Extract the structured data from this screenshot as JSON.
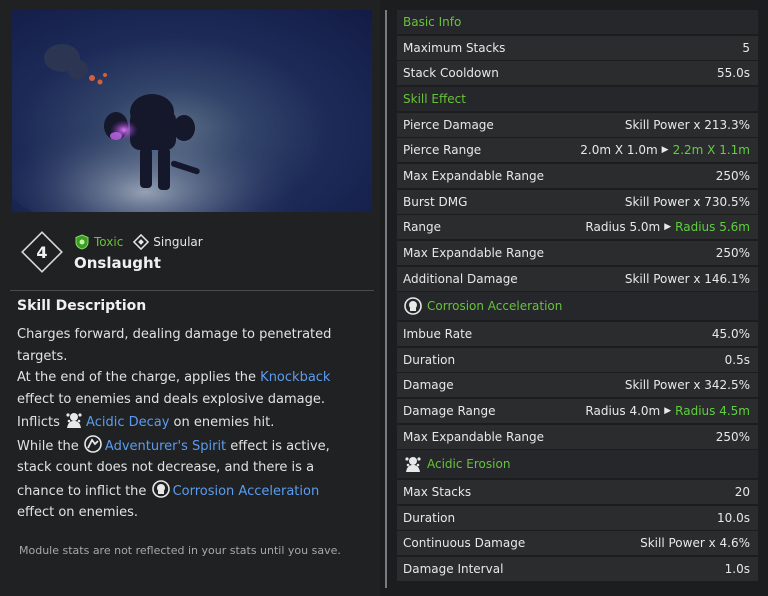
{
  "skill": {
    "slot_number": "4",
    "tags": [
      {
        "label": "Toxic",
        "icon": "toxic-icon",
        "color": "#67c23a"
      },
      {
        "label": "Singular",
        "icon": "singular-icon",
        "color": "#e6e6e6"
      }
    ],
    "name": "Onslaught"
  },
  "description": {
    "title": "Skill Description",
    "line1": "Charges forward, dealing damage to penetrated",
    "line2": "targets.",
    "line3_pre": "At the end of the charge, applies the ",
    "line3_kw": "Knockback",
    "line4": "effect to enemies and deals explosive damage.",
    "line5_pre": "Inflicts ",
    "line5_kw": "Acidic Decay",
    "line5_post": " on enemies hit.",
    "line6_pre": "While the ",
    "line6_kw": "Adventurer's Spirit",
    "line6_post": " effect is active,",
    "line7": "stack count does not decrease, and there is a",
    "line8_pre": "chance to inflict the ",
    "line8_kw": "Corrosion Acceleration",
    "line9": "effect on enemies.",
    "keyword_color": "#5b9cf0"
  },
  "note": "Module stats are not reflected in your stats until you save.",
  "stats": {
    "basic_info": "Basic Info",
    "max_stacks_label": "Maximum Stacks",
    "max_stacks_value": "5",
    "stack_cooldown_label": "Stack Cooldown",
    "stack_cooldown_value": "55.0s",
    "skill_effect": "Skill Effect",
    "pierce_damage_label": "Pierce Damage",
    "pierce_damage_value": "Skill Power x 213.3%",
    "pierce_range_label": "Pierce Range",
    "pierce_range_old": "2.0m X 1.0m",
    "pierce_range_new": "2.2m X 1.1m",
    "max_exp_range_label_1": "Max Expandable Range",
    "max_exp_range_value_1": "250%",
    "burst_dmg_label": "Burst DMG",
    "burst_dmg_value": "Skill Power x 730.5%",
    "range_label": "Range",
    "range_old": "Radius 5.0m",
    "range_new": "Radius 5.6m",
    "max_exp_range_label_2": "Max Expandable Range",
    "max_exp_range_value_2": "250%",
    "additional_damage_label": "Additional Damage",
    "additional_damage_value": "Skill Power x 146.1%",
    "corrosion_acceleration": "Corrosion Acceleration",
    "imbue_rate_label": "Imbue Rate",
    "imbue_rate_value": "45.0%",
    "duration_label_1": "Duration",
    "duration_value_1": "0.5s",
    "damage_label": "Damage",
    "damage_value": "Skill Power x 342.5%",
    "damage_range_label": "Damage Range",
    "damage_range_old": "Radius 4.0m",
    "damage_range_new": "Radius 4.5m",
    "max_exp_range_label_3": "Max Expandable Range",
    "max_exp_range_value_3": "250%",
    "acidic_erosion": "Acidic Erosion",
    "max_stacks_2_label": "Max Stacks",
    "max_stacks_2_value": "20",
    "duration_label_2": "Duration",
    "duration_value_2": "10.0s",
    "continuous_damage_label": "Continuous Damage",
    "continuous_damage_value": "Skill Power x 4.6%",
    "damage_interval_label": "Damage Interval",
    "damage_interval_value": "1.0s",
    "section_color": "#67c23a",
    "upgrade_color": "#5fcf3f"
  }
}
